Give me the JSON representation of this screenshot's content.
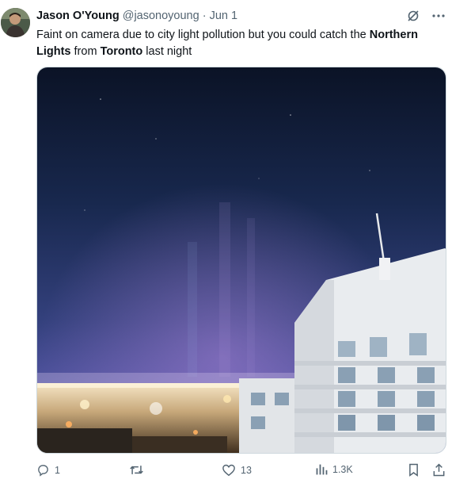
{
  "tweet": {
    "author_name": "Jason O'Young",
    "handle": "@jasonoyoung",
    "separator": "·",
    "date": "Jun 1",
    "text_parts": [
      "Faint on camera due to city light pollution but you could catch the ",
      "Northern Lights",
      " from ",
      "Toronto",
      " last night"
    ]
  },
  "icons": {
    "grok": "grok-icon",
    "more": "more-icon",
    "reply": "reply-icon",
    "retweet": "retweet-icon",
    "like": "heart-icon",
    "views": "views-icon",
    "bookmark": "bookmark-icon",
    "share": "share-icon"
  },
  "actions": {
    "replies": "1",
    "likes": "13",
    "views": "1.3K"
  },
  "colors": {
    "text": "#0f1419",
    "muted": "#536471",
    "sky_top": "#0c1428",
    "sky_bottom": "#4a4f9a"
  }
}
